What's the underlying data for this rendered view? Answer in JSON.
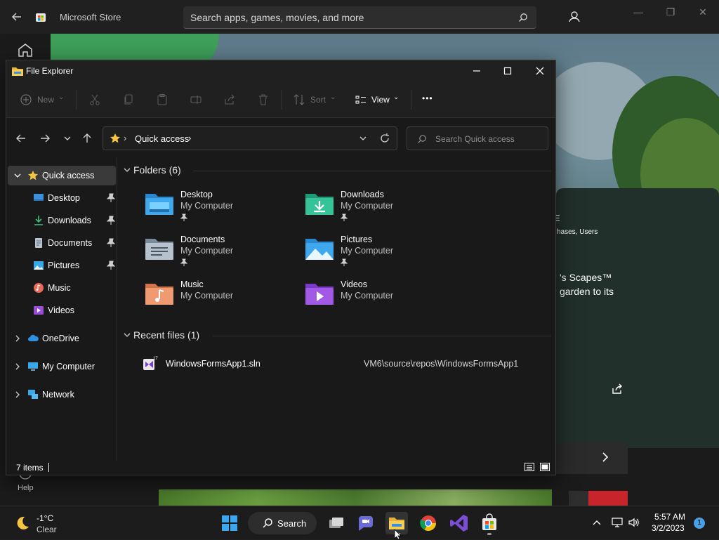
{
  "store": {
    "title": "Microsoft Store",
    "search_placeholder": "Search apps, games, movies, and more",
    "help_label": "Help",
    "hero_badge": "E",
    "hero_meta": "hases, Users",
    "hero_line1": "'s Scapes™",
    "hero_line2": "garden to its"
  },
  "explorer": {
    "title": "File Explorer",
    "toolbar": {
      "new_label": "New",
      "sort_label": "Sort",
      "view_label": "View",
      "more_label": "•••"
    },
    "address": {
      "path_label": "Quick access",
      "search_placeholder": "Search Quick access"
    },
    "sidebar": {
      "items": [
        {
          "label": "Quick access",
          "icon": "star-icon"
        },
        {
          "label": "Desktop",
          "icon": "desktop-icon",
          "pinned": true
        },
        {
          "label": "Downloads",
          "icon": "download-icon",
          "pinned": true
        },
        {
          "label": "Documents",
          "icon": "document-icon",
          "pinned": true
        },
        {
          "label": "Pictures",
          "icon": "pictures-icon",
          "pinned": true
        },
        {
          "label": "Music",
          "icon": "music-icon"
        },
        {
          "label": "Videos",
          "icon": "videos-icon"
        },
        {
          "label": "OneDrive",
          "icon": "cloud-icon"
        },
        {
          "label": "My Computer",
          "icon": "computer-icon"
        },
        {
          "label": "Network",
          "icon": "network-icon"
        }
      ]
    },
    "folders_header": "Folders (6)",
    "folders": [
      {
        "name": "Desktop",
        "location": "My Computer",
        "pinned": true
      },
      {
        "name": "Downloads",
        "location": "My Computer",
        "pinned": true
      },
      {
        "name": "Documents",
        "location": "My Computer",
        "pinned": true
      },
      {
        "name": "Pictures",
        "location": "My Computer",
        "pinned": true
      },
      {
        "name": "Music",
        "location": "My Computer",
        "pinned": false
      },
      {
        "name": "Videos",
        "location": "My Computer",
        "pinned": false
      }
    ],
    "recent_header": "Recent files (1)",
    "recent": [
      {
        "name": "WindowsFormsApp1.sln",
        "path": "VM6\\source\\repos\\WindowsFormsApp1"
      }
    ],
    "status": "7 items"
  },
  "taskbar": {
    "weather_temp": "-1°C",
    "weather_condition": "Clear",
    "search_label": "Search",
    "time": "5:57 AM",
    "date": "3/2/2023",
    "notification_count": "1"
  },
  "colors": {
    "accent": "#4aa0e6",
    "folder_yellow": "#f4c542",
    "window_bg": "#191919"
  }
}
